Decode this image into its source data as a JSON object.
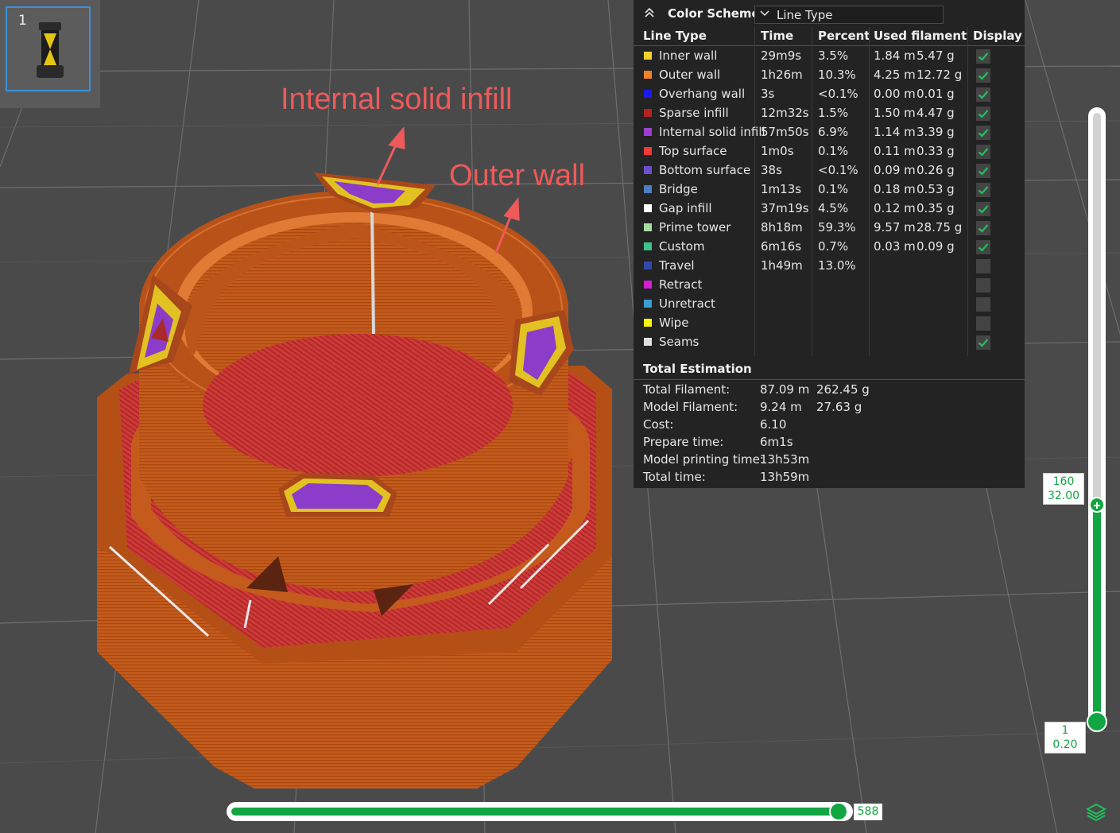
{
  "plate": {
    "number": "1"
  },
  "annotations": {
    "infill": "Internal solid infill",
    "wall": "Outer wall"
  },
  "legend": {
    "title": "Color Scheme",
    "scheme": "Line Type",
    "headers": [
      "Line Type",
      "Time",
      "Percent",
      "Used filament",
      "Display"
    ],
    "rows": [
      {
        "name": "Inner wall",
        "color": "#f1d22c",
        "time": "29m9s",
        "percent": "3.5%",
        "length": "1.84 m",
        "weight": "5.47 g",
        "display": true
      },
      {
        "name": "Outer wall",
        "color": "#f4812a",
        "time": "1h26m",
        "percent": "10.3%",
        "length": "4.25 m",
        "weight": "12.72 g",
        "display": true
      },
      {
        "name": "Overhang wall",
        "color": "#1a1af0",
        "time": "3s",
        "percent": "<0.1%",
        "length": "0.00 m",
        "weight": "0.01 g",
        "display": true
      },
      {
        "name": "Sparse infill",
        "color": "#b22323",
        "time": "12m32s",
        "percent": "1.5%",
        "length": "1.50 m",
        "weight": "4.47 g",
        "display": true
      },
      {
        "name": "Internal solid infill",
        "color": "#9b3fd1",
        "time": "57m50s",
        "percent": "6.9%",
        "length": "1.14 m",
        "weight": "3.39 g",
        "display": true
      },
      {
        "name": "Top surface",
        "color": "#f23838",
        "time": "1m0s",
        "percent": "0.1%",
        "length": "0.11 m",
        "weight": "0.33 g",
        "display": true
      },
      {
        "name": "Bottom surface",
        "color": "#6b4fd0",
        "time": "38s",
        "percent": "<0.1%",
        "length": "0.09 m",
        "weight": "0.26 g",
        "display": true
      },
      {
        "name": "Bridge",
        "color": "#4b7fc4",
        "time": "1m13s",
        "percent": "0.1%",
        "length": "0.18 m",
        "weight": "0.53 g",
        "display": true
      },
      {
        "name": "Gap infill",
        "color": "#ffffff",
        "time": "37m19s",
        "percent": "4.5%",
        "length": "0.12 m",
        "weight": "0.35 g",
        "display": true
      },
      {
        "name": "Prime tower",
        "color": "#a6dba0",
        "time": "8h18m",
        "percent": "59.3%",
        "length": "9.57 m",
        "weight": "28.75 g",
        "display": true
      },
      {
        "name": "Custom",
        "color": "#3ec18a",
        "time": "6m16s",
        "percent": "0.7%",
        "length": "0.03 m",
        "weight": "0.09 g",
        "display": true
      },
      {
        "name": "Travel",
        "color": "#3548a8",
        "time": "1h49m",
        "percent": "13.0%",
        "length": "",
        "weight": "",
        "display": false
      },
      {
        "name": "Retract",
        "color": "#d11fd1",
        "time": "",
        "percent": "",
        "length": "",
        "weight": "",
        "display": false
      },
      {
        "name": "Unretract",
        "color": "#3a9fd0",
        "time": "",
        "percent": "",
        "length": "",
        "weight": "",
        "display": false
      },
      {
        "name": "Wipe",
        "color": "#f5f50f",
        "time": "",
        "percent": "",
        "length": "",
        "weight": "",
        "display": false
      },
      {
        "name": "Seams",
        "color": "#e0e0e0",
        "time": "",
        "percent": "",
        "length": "",
        "weight": "",
        "display": true
      }
    ]
  },
  "total_estimation": {
    "title": "Total Estimation",
    "rows": [
      {
        "label": "Total Filament:",
        "v1": "87.09 m",
        "v2": "262.45 g"
      },
      {
        "label": "Model Filament:",
        "v1": "9.24 m",
        "v2": "27.63 g"
      },
      {
        "label": "Cost:",
        "v1": "6.10",
        "v2": ""
      },
      {
        "label": "Prepare time:",
        "v1": "6m1s",
        "v2": ""
      },
      {
        "label": "Model printing time:",
        "v1": "13h53m",
        "v2": ""
      },
      {
        "label": "Total time:",
        "v1": "13h59m",
        "v2": ""
      }
    ]
  },
  "layer_slider": {
    "top_layer": "160",
    "top_height": "32.00",
    "bottom_layer": "1",
    "bottom_height": "0.20"
  },
  "move_slider": {
    "value": "588"
  },
  "colors": {
    "accent": "#11a642",
    "check": "#1fc25a",
    "outer_wall": "#c25a1c",
    "top_surface": "#c9373a"
  }
}
